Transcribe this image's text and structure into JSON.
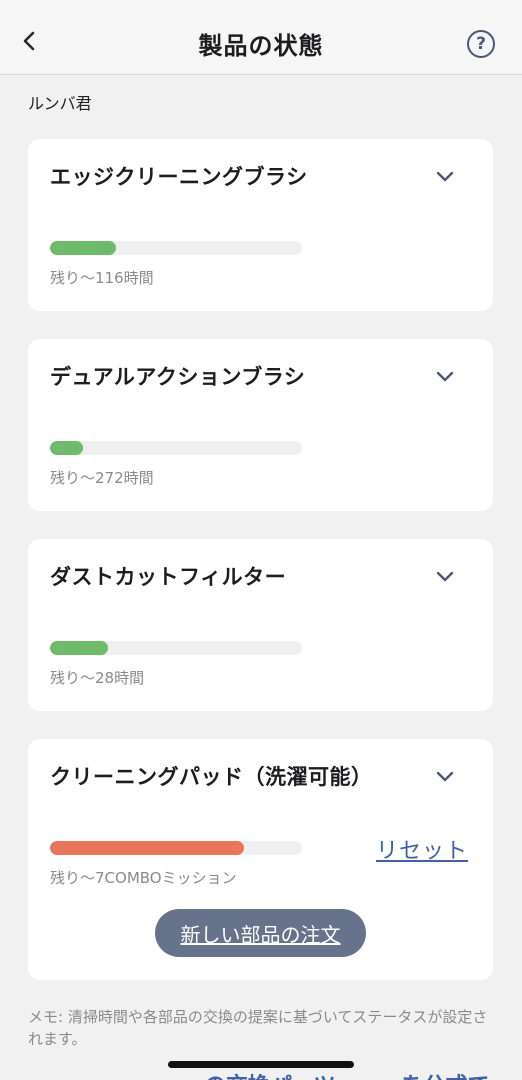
{
  "header": {
    "title": "製品の状態",
    "back_icon": "chevron-left-icon",
    "help_icon": "question-circle-icon"
  },
  "device_name": "ルンバ君",
  "parts": [
    {
      "name": "エッジクリーニングブラシ",
      "remaining": "残り〜116時間",
      "level": 0.26,
      "color": "#6cba6a"
    },
    {
      "name": "デュアルアクションブラシ",
      "remaining": "残り〜272時間",
      "level": 0.13,
      "color": "#6cba6a"
    },
    {
      "name": "ダストカットフィルター",
      "remaining": "残り〜28時間",
      "level": 0.23,
      "color": "#6cba6a"
    },
    {
      "name": "クリーニングパッド（洗濯可能）",
      "remaining": "残り〜7COMBOミッション",
      "level": 0.77,
      "color": "#e8765a",
      "reset_label": "リセット",
      "order_label": "新しい部品の注文"
    }
  ],
  "note": "メモ: 清掃時間や各部品の交換の提案に基づいてステータスが設定されます。",
  "footer_link_cut": "・・・・・・・・の交換パーツ・・・を公式で"
}
